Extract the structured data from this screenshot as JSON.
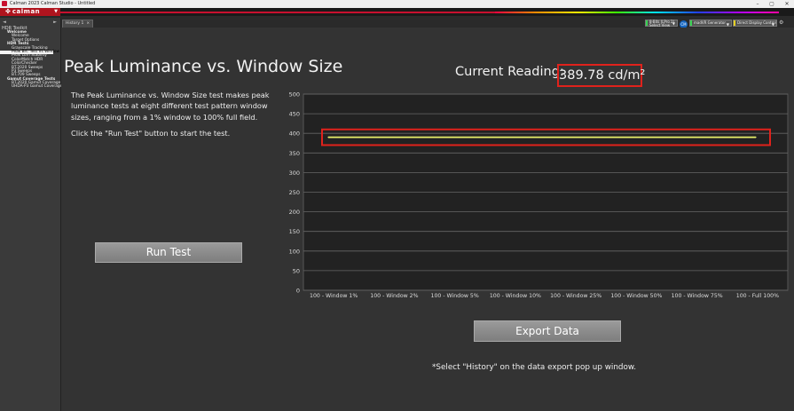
{
  "window": {
    "title": "Calman 2023 Calman Studio - Untitled",
    "controls": [
      "–",
      "▢",
      "✕"
    ]
  },
  "brand": {
    "logo_text": "calman"
  },
  "tab": {
    "label": "History 1",
    "close": "×"
  },
  "controls": [
    {
      "label": "8-Bits (LPro 2)",
      "sub": "Select View",
      "accent": "#39d353"
    },
    {
      "label": "madVR Generator",
      "sub": "",
      "accent": "#39d353"
    },
    {
      "label": "Direct Display Control",
      "sub": "",
      "accent": "#e6d020"
    }
  ],
  "badge": "CM",
  "sidebar": {
    "heading": "HDR Toolkit",
    "items": [
      {
        "label": "Welcome",
        "level": 1,
        "selected": false
      },
      {
        "label": "Welcome",
        "level": 2,
        "selected": false
      },
      {
        "label": "Target Options",
        "level": 2,
        "selected": false
      },
      {
        "label": "HDR Tests",
        "level": 1,
        "selected": false
      },
      {
        "label": "Grayscale Tracking",
        "level": 2,
        "selected": false
      },
      {
        "label": "Peak Brt. Test Vs Window",
        "level": 2,
        "selected": true
      },
      {
        "label": "Peak Lum Stability",
        "level": 2,
        "selected": false
      },
      {
        "label": "ColorMatch HDR",
        "level": 2,
        "selected": false
      },
      {
        "label": "ColorChecker",
        "level": 2,
        "selected": false
      },
      {
        "label": "BT.2020 Sweeps",
        "level": 2,
        "selected": false
      },
      {
        "label": "P3 Sweeps",
        "level": 2,
        "selected": false
      },
      {
        "label": "BT.709 Sweeps",
        "level": 2,
        "selected": false
      },
      {
        "label": "Gamut Coverage Tests",
        "level": 1,
        "selected": false
      },
      {
        "label": "BT.2020 Gamut Coverage",
        "level": 2,
        "selected": false
      },
      {
        "label": "UHDA-P3 Gamut Coverage",
        "level": 2,
        "selected": false
      }
    ]
  },
  "page": {
    "title": "Peak Luminance vs. Window Size",
    "description": "The Peak Luminance vs. Window Size test makes peak luminance tests at eight different test pattern window sizes, ranging from a 1% window to 100% full field.",
    "instruction": "Click the \"Run Test\" button to start the test.",
    "run_button": "Run Test",
    "export_button": "Export  Data",
    "footnote": "*Select \"History\" on the data export pop up window.",
    "reading_label": "Current Reading:",
    "reading_value": "389.78 cd/m²"
  },
  "colors": {
    "accent_red": "#e0221c",
    "line": "#e8f06a",
    "chart_bg": "#222222"
  },
  "chart_data": {
    "type": "line",
    "categories": [
      "100 - Window  1%",
      "100 - Window  2%",
      "100 - Window  5%",
      "100 - Window 10%",
      "100 - Window 25%",
      "100 - Window 50%",
      "100 - Window 75%",
      "100 - Full  100%"
    ],
    "series": [
      {
        "values": [
          390,
          390,
          390,
          390,
          390,
          390,
          390,
          390
        ]
      }
    ],
    "ylim": [
      0,
      500
    ],
    "yticks": [
      0,
      50,
      100,
      150,
      200,
      250,
      300,
      350,
      400,
      450,
      500
    ],
    "grid": true,
    "highlight_range": [
      370,
      410
    ]
  }
}
